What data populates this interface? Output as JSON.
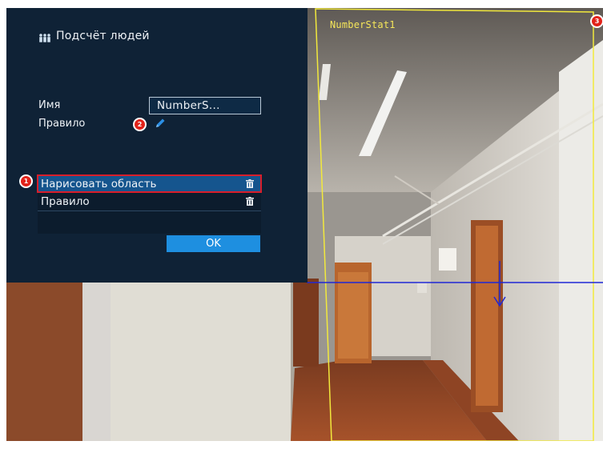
{
  "dialog": {
    "title": "Подсчёт людей",
    "name_label": "Имя",
    "name_value": "NumberS...",
    "rule_label": "Правило",
    "list_items": [
      {
        "label": "Нарисовать область",
        "selected": true
      },
      {
        "label": "Правило",
        "selected": false
      }
    ],
    "ok_label": "OK"
  },
  "overlay": {
    "rule_name": "NumberStat1",
    "region_color": "#f2e93c",
    "line_color": "#1f27d6",
    "direction": "down"
  },
  "annotations": {
    "badge_1": "1",
    "badge_2": "2",
    "badge_3": "3",
    "highlight_color": "#d91e2a"
  },
  "colors": {
    "dialog_bg": "#0f2236",
    "selected_row": "#15558e",
    "ok_button": "#1e8fe0",
    "edit_icon": "#2b8fe6"
  }
}
